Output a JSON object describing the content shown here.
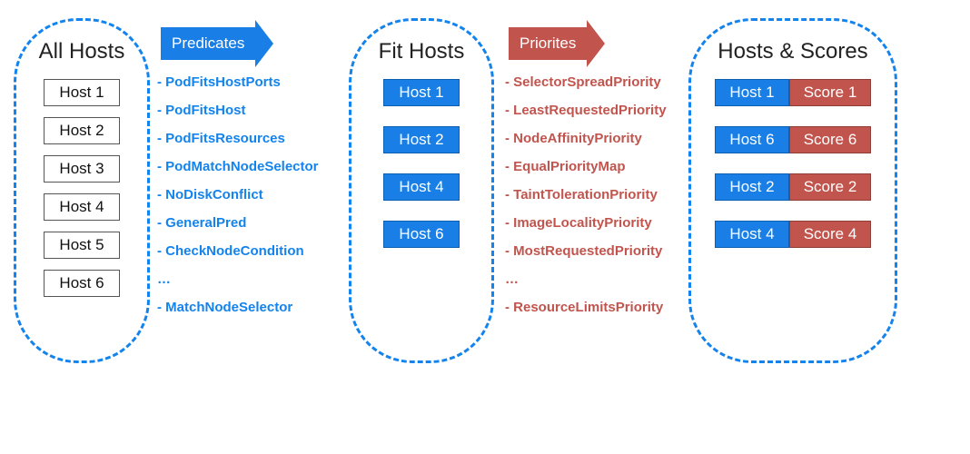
{
  "colors": {
    "blue": "#197fe6",
    "red": "#c1554e",
    "dashed": "#1383ed"
  },
  "stages": {
    "all": {
      "title": "All Hosts",
      "hosts": [
        "Host 1",
        "Host 2",
        "Host 3",
        "Host 4",
        "Host 5",
        "Host 6"
      ]
    },
    "fit": {
      "title": "Fit Hosts",
      "hosts": [
        "Host 1",
        "Host 2",
        "Host 4",
        "Host 6"
      ]
    },
    "score": {
      "title": "Hosts & Scores",
      "rows": [
        {
          "host": "Host 1",
          "score": "Score 1"
        },
        {
          "host": "Host 6",
          "score": "Score 6"
        },
        {
          "host": "Host 2",
          "score": "Score 2"
        },
        {
          "host": "Host 4",
          "score": "Score 4"
        }
      ]
    }
  },
  "predicates": {
    "arrow_label": "Predicates",
    "items": [
      "- PodFitsHostPorts",
      "- PodFitsHost",
      "- PodFitsResources",
      "- PodMatchNodeSelector",
      "- NoDiskConflict",
      "- GeneralPred",
      "- CheckNodeCondition",
      "…",
      "- MatchNodeSelector"
    ]
  },
  "priorities": {
    "arrow_label": "Priorites",
    "items": [
      "- SelectorSpreadPriority",
      "- LeastRequestedPriority",
      "- NodeAffinityPriority",
      "- EqualPriorityMap",
      "- TaintTolerationPriority",
      "- ImageLocalityPriority",
      "- MostRequestedPriority",
      "…",
      "- ResourceLimitsPriority"
    ]
  }
}
